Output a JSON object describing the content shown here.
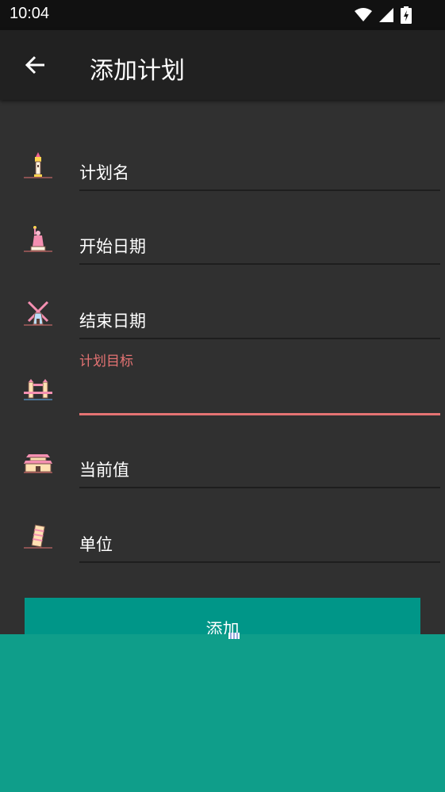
{
  "status": {
    "time": "10:04",
    "icons": [
      "wifi-icon",
      "signal-icon",
      "battery-charging-icon"
    ]
  },
  "appbar": {
    "title": "添加计划",
    "back_icon": "arrow-back-icon"
  },
  "form": {
    "plan_name": "计划名",
    "start_date": "开始日期",
    "end_date": "结束日期",
    "target_label": "计划目标",
    "target_value": "",
    "current_value": "当前值",
    "unit": "单位"
  },
  "actions": {
    "add_label": "添加"
  },
  "colors": {
    "background": "#303030",
    "appbar": "#212121",
    "accent": "#009688",
    "error": "#e57373"
  }
}
